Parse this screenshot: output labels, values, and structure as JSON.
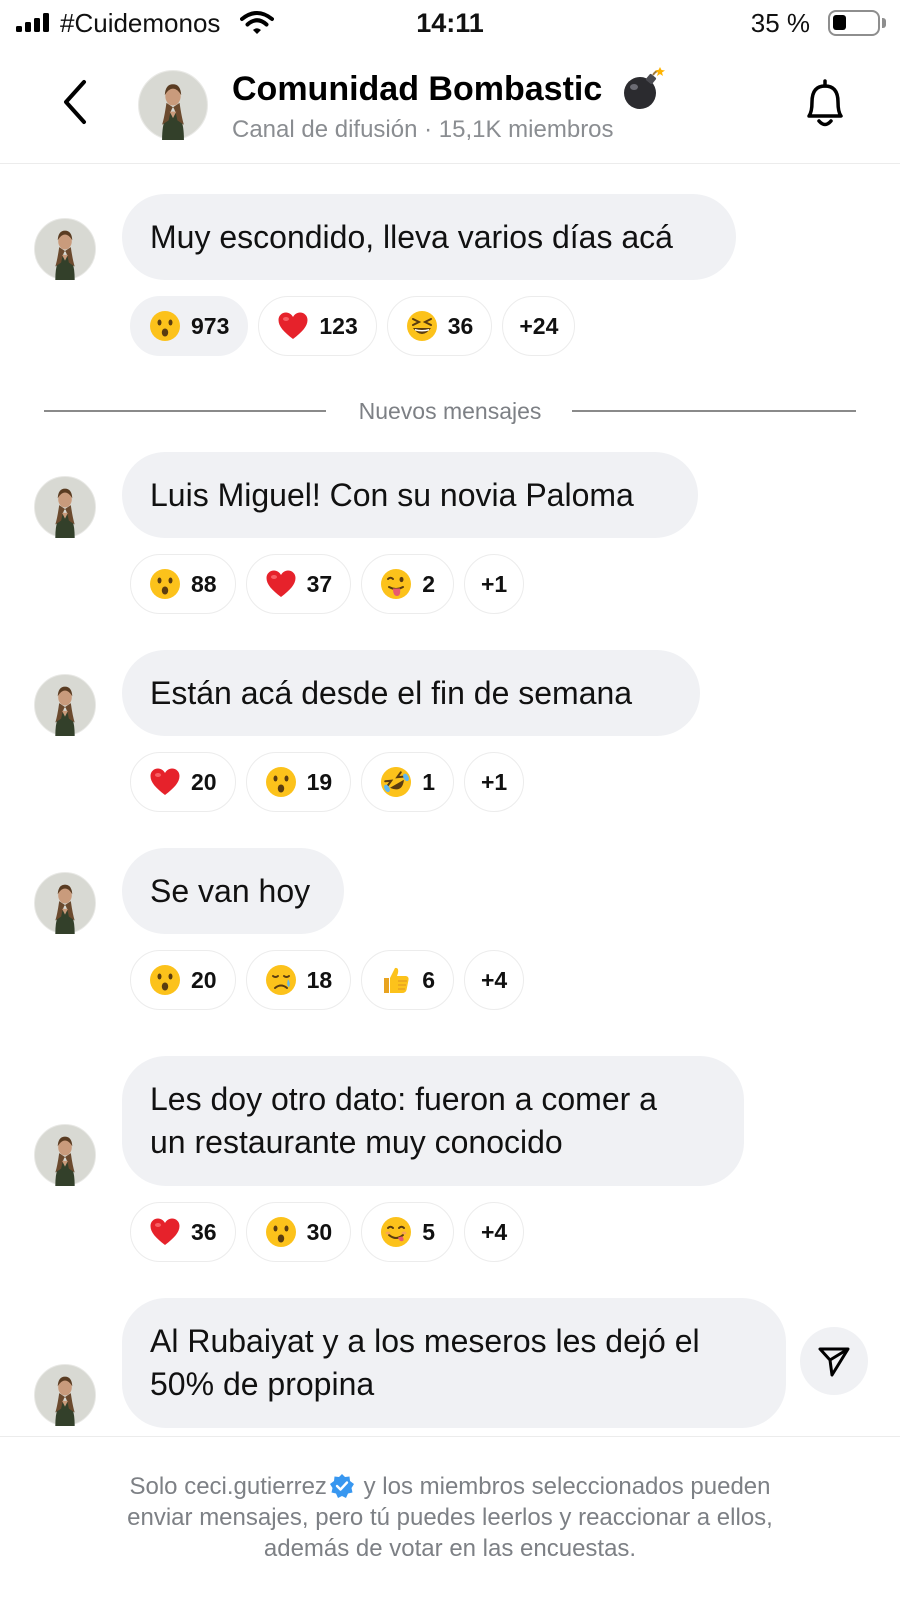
{
  "status_bar": {
    "carrier": "#Cuidemonos",
    "time": "14:11",
    "battery": "35 %"
  },
  "header": {
    "title": "Comunidad Bombastic",
    "subtitle": "Canal de difusión · 15,1K miembros",
    "title_emoji": "bomb-icon"
  },
  "divider_label": "Nuevos mensajes",
  "messages": [
    {
      "text": "Muy escondido, lleva varios días acá",
      "reactions": [
        {
          "emoji": "astonished-face-icon",
          "count": "973",
          "selected": true
        },
        {
          "emoji": "red-heart-icon",
          "count": "123"
        },
        {
          "emoji": "grinning-squinting-face-icon",
          "count": "36"
        },
        {
          "more": "+24"
        }
      ]
    },
    {
      "text": "Luis Miguel! Con su novia Paloma",
      "reactions": [
        {
          "emoji": "astonished-face-icon",
          "count": "88"
        },
        {
          "emoji": "red-heart-icon",
          "count": "37"
        },
        {
          "emoji": "face-with-tongue-icon",
          "count": "2"
        },
        {
          "more": "+1"
        }
      ]
    },
    {
      "text": "Están acá desde el fin de semana",
      "reactions": [
        {
          "emoji": "red-heart-icon",
          "count": "20"
        },
        {
          "emoji": "astonished-face-icon",
          "count": "19"
        },
        {
          "emoji": "rolling-laughing-face-icon",
          "count": "1"
        },
        {
          "more": "+1"
        }
      ]
    },
    {
      "text": "Se van hoy",
      "reactions": [
        {
          "emoji": "astonished-face-icon",
          "count": "20"
        },
        {
          "emoji": "crying-face-icon",
          "count": "18"
        },
        {
          "emoji": "thumbs-up-icon",
          "count": "6"
        },
        {
          "more": "+4"
        }
      ]
    },
    {
      "text_lines": [
        "Les doy otro dato: fueron a comer a",
        "un restaurante muy conocido"
      ],
      "reactions": [
        {
          "emoji": "red-heart-icon",
          "count": "36"
        },
        {
          "emoji": "astonished-face-icon",
          "count": "30"
        },
        {
          "emoji": "yum-face-icon",
          "count": "5"
        },
        {
          "more": "+4"
        }
      ]
    },
    {
      "text_lines": [
        "Al Rubaiyat y a los meseros les dejó el",
        "50% de propina"
      ]
    }
  ],
  "footer": {
    "prefix": "Solo",
    "username": "ceci.gutierrez",
    "line1_rest": "y los miembros seleccionados pueden",
    "line2": "enviar mensajes, pero tú puedes leerlos y reaccionar a ellos,",
    "line3": "además de votar en las encuestas."
  },
  "colors": {
    "bubble": "#f0f1f4",
    "secondary_text": "#8a8d91",
    "verified_blue": "#3897f0"
  }
}
